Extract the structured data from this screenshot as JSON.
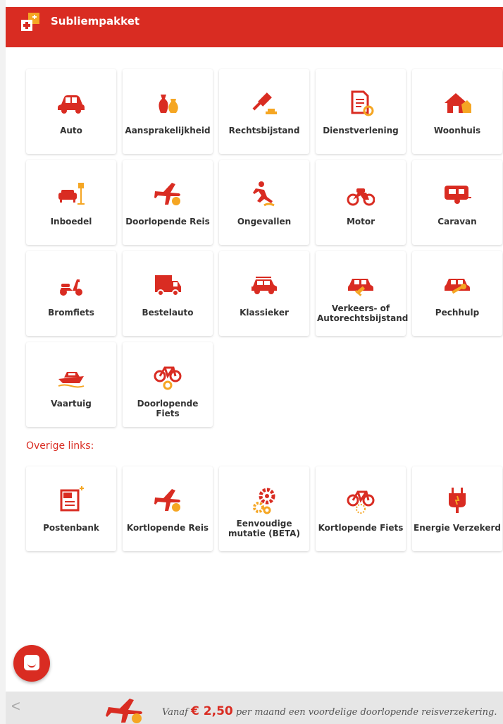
{
  "app": {
    "title": "Subliempakket"
  },
  "colors": {
    "brand_red": "#d92c22",
    "accent_orange": "#f5a623"
  },
  "tiles": [
    {
      "label": "Auto",
      "icon": "car-icon"
    },
    {
      "label": "Aansprakelijkheid",
      "icon": "vase-icon"
    },
    {
      "label": "Rechtsbijstand",
      "icon": "gavel-icon"
    },
    {
      "label": "Dienstverlening",
      "icon": "document-refresh-icon"
    },
    {
      "label": "Woonhuis",
      "icon": "house-icon"
    },
    {
      "label": "Inboedel",
      "icon": "sofa-lamp-icon"
    },
    {
      "label": "Doorlopende Reis",
      "icon": "airplane-globe-icon"
    },
    {
      "label": "Ongevallen",
      "icon": "falling-person-icon"
    },
    {
      "label": "Motor",
      "icon": "motorcycle-icon"
    },
    {
      "label": "Caravan",
      "icon": "caravan-icon"
    },
    {
      "label": "Bromfiets",
      "icon": "scooter-icon"
    },
    {
      "label": "Bestelauto",
      "icon": "van-icon"
    },
    {
      "label": "Klassieker",
      "icon": "classic-car-icon"
    },
    {
      "label": "Verkeers- of Autorechtsbijstand",
      "icon": "car-gavel-icon"
    },
    {
      "label": "Pechhulp",
      "icon": "car-wrench-icon"
    },
    {
      "label": "Vaartuig",
      "icon": "boat-icon"
    },
    {
      "label": "Doorlopende Fiets",
      "icon": "bicycle-refresh-icon"
    }
  ],
  "other_links_heading": "Overige links:",
  "other_links": [
    {
      "label": "Postenbank",
      "icon": "postenbank-document-icon"
    },
    {
      "label": "Kortlopende Reis",
      "icon": "airplane-globe-icon"
    },
    {
      "label": "Eenvoudige mutatie (BETA)",
      "icon": "gears-icon"
    },
    {
      "label": "Kortlopende Fiets",
      "icon": "bicycle-clock-icon"
    },
    {
      "label": "Energie Verzekerd",
      "icon": "plug-icon"
    }
  ],
  "banner": {
    "prefix": "Vanaf",
    "price": "€ 2,50",
    "suffix": "per maand een voordelige doorlopende reisverzekering.",
    "nav_left": "<"
  }
}
